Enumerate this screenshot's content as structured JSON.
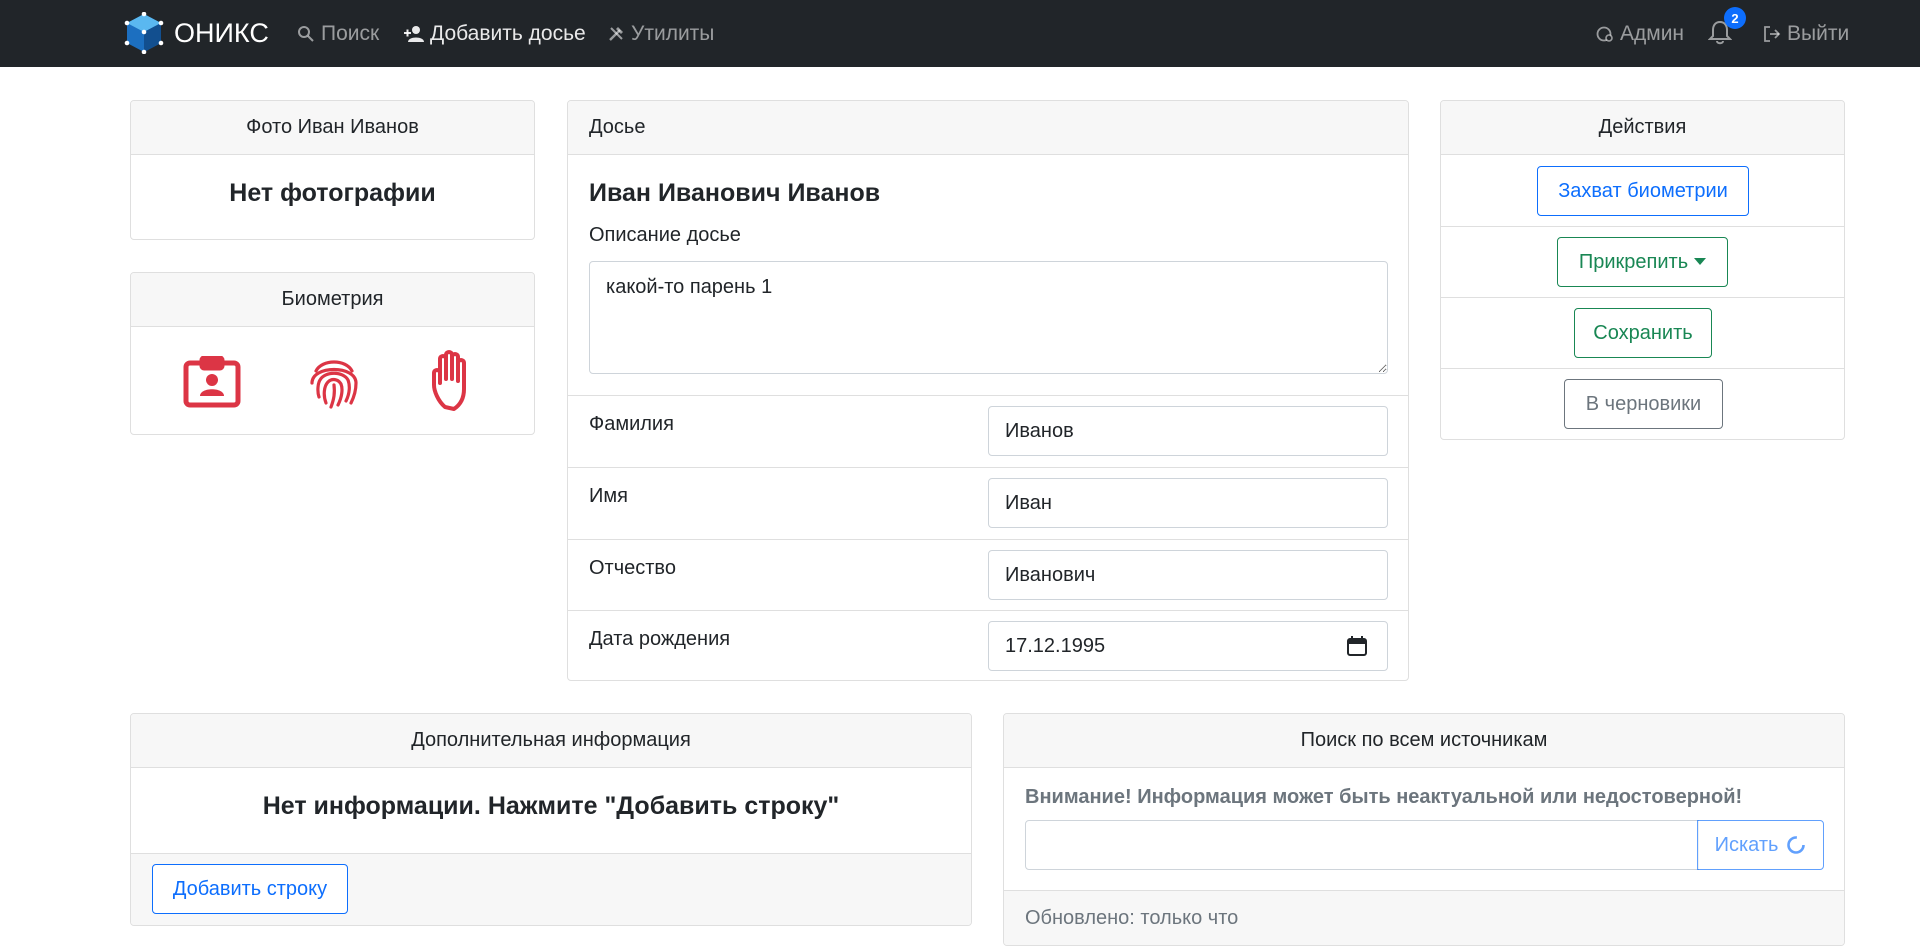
{
  "navbar": {
    "brand": "ОНИКС",
    "items": [
      {
        "label": "Поиск",
        "icon": "search-icon"
      },
      {
        "label": "Добавить досье",
        "icon": "person-plus-icon"
      },
      {
        "label": "Утилиты",
        "icon": "tools-icon"
      }
    ],
    "admin_label": "Админ",
    "notifications_count": "2",
    "logout_label": "Выйти"
  },
  "photo_card": {
    "title": "Фото Иван Иванов",
    "empty_text": "Нет фотографии"
  },
  "biometry_card": {
    "title": "Биометрия",
    "icons": [
      "person-badge-icon",
      "fingerprint-icon",
      "hand-palm-icon"
    ],
    "icon_color": "#dc3545"
  },
  "dossier_card": {
    "title": "Досье",
    "full_name": "Иван Иванович Иванов",
    "description_label": "Описание досье",
    "description_value": "какой-то парень 1",
    "fields": [
      {
        "label": "Фамилия",
        "value": "Иванов"
      },
      {
        "label": "Имя",
        "value": "Иван"
      },
      {
        "label": "Отчество",
        "value": "Иванович"
      },
      {
        "label": "Дата рождения",
        "value": "17.12.1995"
      }
    ]
  },
  "actions_card": {
    "title": "Действия",
    "capture_label": "Захват биометрии",
    "attach_label": "Прикрепить",
    "save_label": "Сохранить",
    "drafts_label": "В черновики"
  },
  "extra_info_card": {
    "title": "Дополнительная информация",
    "empty_text": "Нет информации. Нажмите \"Добавить строку\"",
    "add_row_label": "Добавить строку"
  },
  "search_card": {
    "title": "Поиск по всем источникам",
    "warning": "Внимание! Информация может быть неактуальной или недостоверной!",
    "query_value": "",
    "search_label": "Искать",
    "updated_text": "Обновлено: только что"
  },
  "colors": {
    "navbar_bg": "#212529",
    "primary": "#0d6efd",
    "success": "#198754",
    "secondary": "#6c757d",
    "danger": "#dc3545"
  }
}
